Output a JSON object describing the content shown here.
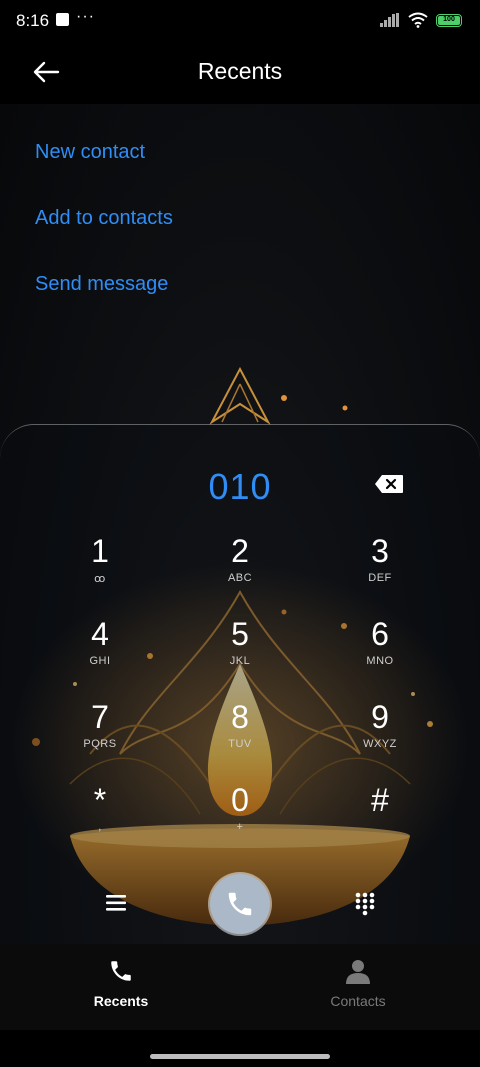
{
  "status_bar": {
    "time": "8:16",
    "dots": "···",
    "battery": "100"
  },
  "header": {
    "title": "Recents"
  },
  "actions": {
    "new_contact": "New contact",
    "add_to_contacts": "Add to contacts",
    "send_message": "Send message"
  },
  "dialer": {
    "number": "010",
    "keys": [
      {
        "digit": "1",
        "letters": "ꝏ"
      },
      {
        "digit": "2",
        "letters": "ABC"
      },
      {
        "digit": "3",
        "letters": "DEF"
      },
      {
        "digit": "4",
        "letters": "GHI"
      },
      {
        "digit": "5",
        "letters": "JKL"
      },
      {
        "digit": "6",
        "letters": "MNO"
      },
      {
        "digit": "7",
        "letters": "PQRS"
      },
      {
        "digit": "8",
        "letters": "TUV"
      },
      {
        "digit": "9",
        "letters": "WXYZ"
      },
      {
        "digit": "*",
        "letters": ","
      },
      {
        "digit": "0",
        "letters": "+"
      },
      {
        "digit": "#",
        "letters": ""
      }
    ]
  },
  "bottom_nav": {
    "recents": {
      "label": "Recents",
      "color": "#ffffff"
    },
    "contacts": {
      "label": "Contacts",
      "color": "#7a7a7a"
    }
  },
  "colors": {
    "accent": "#2f8df5",
    "call_button": "#aab8c7"
  },
  "icons": {
    "back": "arrow-left-icon",
    "backspace": "backspace-icon",
    "menu": "menu-icon",
    "call": "phone-icon",
    "keypad": "dialpad-icon",
    "recents_tab": "phone-icon",
    "contacts_tab": "person-icon"
  }
}
